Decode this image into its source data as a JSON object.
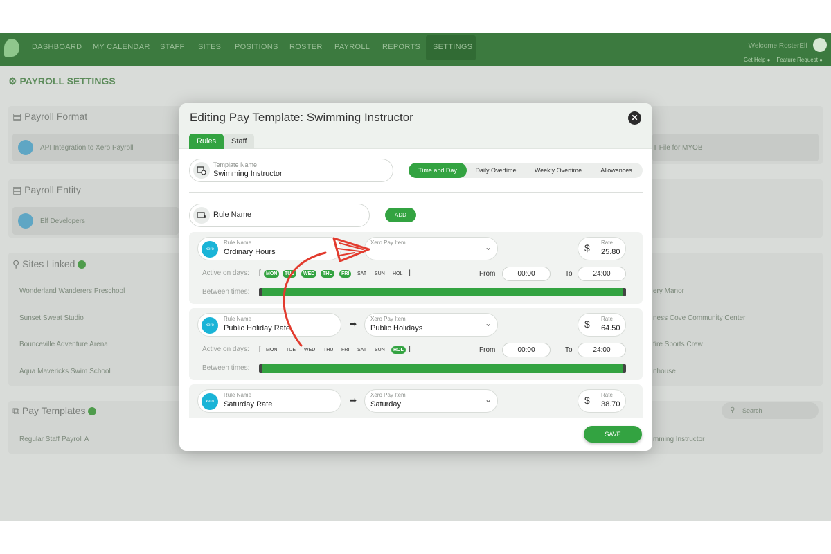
{
  "nav": {
    "items": [
      "DASHBOARD",
      "MY CALENDAR",
      "STAFF",
      "SITES",
      "POSITIONS",
      "ROSTER",
      "PAYROLL",
      "REPORTS",
      "SETTINGS"
    ],
    "welcome": "Welcome RosterElf",
    "sub_links": "Get Help ❓ &nbsp; Feature Request ✦"
  },
  "background": {
    "page_title": "PAYROLL SETTINGS",
    "payroll_format": {
      "title": "Payroll Format",
      "left_item": "API Integration to Xero Payroll",
      "right_item": "T File for MYOB"
    },
    "payroll_entity": {
      "title": "Payroll Entity",
      "item": "Elf Developers"
    },
    "sites_linked": {
      "title": "Sites Linked",
      "left": [
        "Wonderland Wanderers Preschool",
        "Sunset Sweat Studio",
        "Bounceville Adventure Arena",
        "Aqua Mavericks Swim School"
      ],
      "right": [
        "ery Manor",
        "ness Cove Community Center",
        "fire Sports Crew",
        "nhouse"
      ]
    },
    "pay_templates": {
      "title": "Pay Templates",
      "left_item": "Regular Staff Payroll A",
      "right_item": "mming Instructor",
      "search_placeholder": "Search"
    }
  },
  "modal": {
    "title": "Editing Pay Template: Swimming Instructor",
    "tabs": [
      "Rules",
      "Staff"
    ],
    "template_name_label": "Template Name",
    "template_name_value": "Swimming Instructor",
    "segments": [
      "Time and Day",
      "Daily Overtime",
      "Weekly Overtime",
      "Allowances"
    ],
    "rule_name_placeholder": "Rule Name",
    "add_label": "ADD",
    "save_label": "SAVE",
    "labels": {
      "rule_name": "Rule Name",
      "xero_pay_item": "Xero Pay Item",
      "rate": "Rate",
      "active_on_days": "Active on days:",
      "between_times": "Between times:",
      "from": "From",
      "to": "To",
      "xero": "xero",
      "dollar": "$",
      "open_bracket": "[",
      "close_bracket": "]"
    },
    "rules": [
      {
        "rule_name": "Ordinary Hours",
        "xero_pay_item": "",
        "rate": "25.80",
        "days": [
          {
            "d": "MON",
            "on": true
          },
          {
            "d": "TUE",
            "on": true
          },
          {
            "d": "WED",
            "on": true
          },
          {
            "d": "THU",
            "on": true
          },
          {
            "d": "FRI",
            "on": true
          },
          {
            "d": "SAT",
            "on": false
          },
          {
            "d": "SUN",
            "on": false
          },
          {
            "d": "HOL",
            "on": false
          }
        ],
        "from": "00:00",
        "to": "24:00"
      },
      {
        "rule_name": "Public Holiday Rate",
        "xero_pay_item": "Public Holidays",
        "rate": "64.50",
        "days": [
          {
            "d": "MON",
            "on": false
          },
          {
            "d": "TUE",
            "on": false
          },
          {
            "d": "WED",
            "on": false
          },
          {
            "d": "THU",
            "on": false
          },
          {
            "d": "FRI",
            "on": false
          },
          {
            "d": "SAT",
            "on": false
          },
          {
            "d": "SUN",
            "on": false
          },
          {
            "d": "HOL",
            "on": true
          }
        ],
        "from": "00:00",
        "to": "24:00"
      },
      {
        "rule_name": "Saturday Rate",
        "xero_pay_item": "Saturday",
        "rate": "38.70"
      }
    ]
  },
  "colors": {
    "accent": "#33a341",
    "nav": "#3c7a3f",
    "annotation": "#e23b2e",
    "xero": "#1ab4d7"
  }
}
